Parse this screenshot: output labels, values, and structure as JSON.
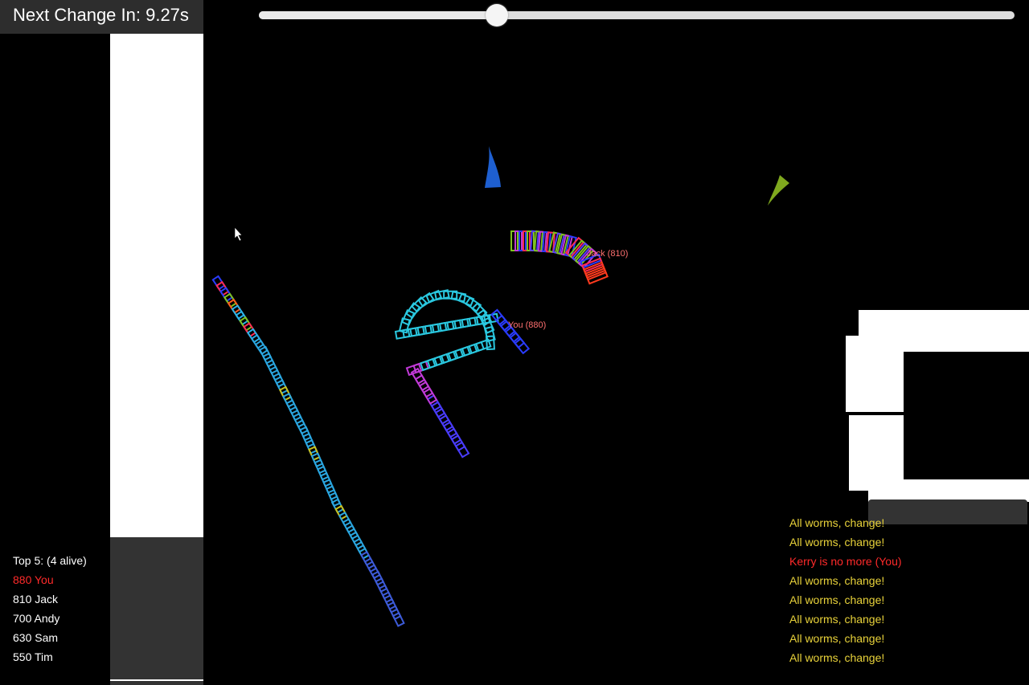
{
  "hud": {
    "timer_text": "Next Change In: 9.27s"
  },
  "speed_slider": {
    "value_fraction": 0.31
  },
  "leaderboard": {
    "title": "Top 5: (4 alive)",
    "entries": [
      {
        "score": "880",
        "name": "You",
        "is_player": true
      },
      {
        "score": "810",
        "name": "Jack",
        "is_player": false
      },
      {
        "score": "700",
        "name": "Andy",
        "is_player": false
      },
      {
        "score": "630",
        "name": "Sam",
        "is_player": false
      },
      {
        "score": "550",
        "name": "Tim",
        "is_player": false
      }
    ]
  },
  "messages": [
    {
      "text": "All worms, change!",
      "kind": "info"
    },
    {
      "text": "All worms, change!",
      "kind": "info"
    },
    {
      "text": "Kerry is no more (You)",
      "kind": "death"
    },
    {
      "text": "All worms, change!",
      "kind": "info"
    },
    {
      "text": "All worms, change!",
      "kind": "info"
    },
    {
      "text": "All worms, change!",
      "kind": "info"
    },
    {
      "text": "All worms, change!",
      "kind": "info"
    },
    {
      "text": "All worms, change!",
      "kind": "info"
    }
  ],
  "worm_labels": {
    "player": "You (880)",
    "jack": "Jack (810)"
  },
  "colors": {
    "background": "#000000",
    "message_info": "#e8d23a",
    "message_death": "#ff2a2a",
    "player_label": "#ff7070"
  }
}
